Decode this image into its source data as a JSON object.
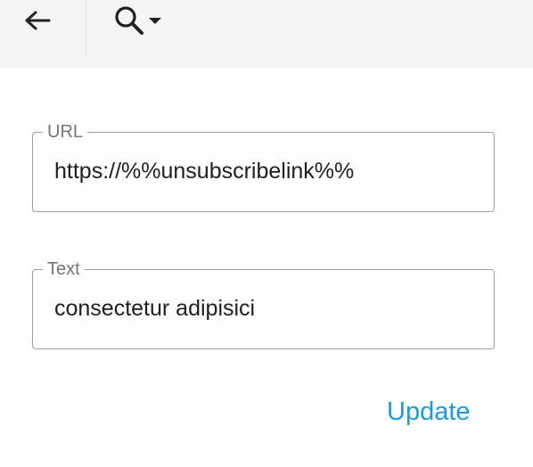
{
  "toolbar": {
    "back_icon": "arrow-left-icon",
    "search_icon": "magnifier-icon",
    "search_menu_icon": "caret-down-icon"
  },
  "form": {
    "url": {
      "label": "URL",
      "value": "https://%%unsubscribelink%%"
    },
    "text": {
      "label": "Text",
      "value": "consectetur adipisici"
    },
    "update_label": "Update"
  },
  "colors": {
    "toolbar_bg": "#f5f5f5",
    "accent": "#1a9be8",
    "border": "#9e9e9e",
    "label": "#757575",
    "text": "#1f1f1f"
  }
}
